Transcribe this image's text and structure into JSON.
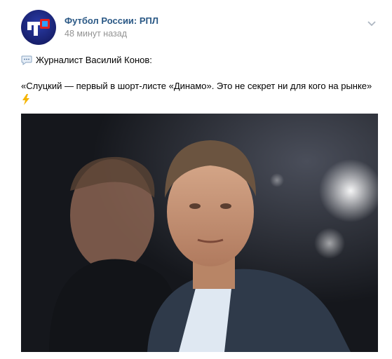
{
  "post": {
    "author": "Футбол России: РПЛ",
    "time": "48 минут назад",
    "line1": "Журналист Василий Конов:",
    "line2": "«Слуцкий — первый в шорт-листе «Динамо». Это не секрет ни для кого на рынке»"
  },
  "icons": {
    "avatar": "community-logo",
    "menu": "chevron-down-icon",
    "speech": "speech-bubble-icon",
    "bolt": "lightning-icon"
  },
  "colors": {
    "author_link": "#2a5885",
    "meta_text": "#939393",
    "page_bg": "#edeef0"
  }
}
